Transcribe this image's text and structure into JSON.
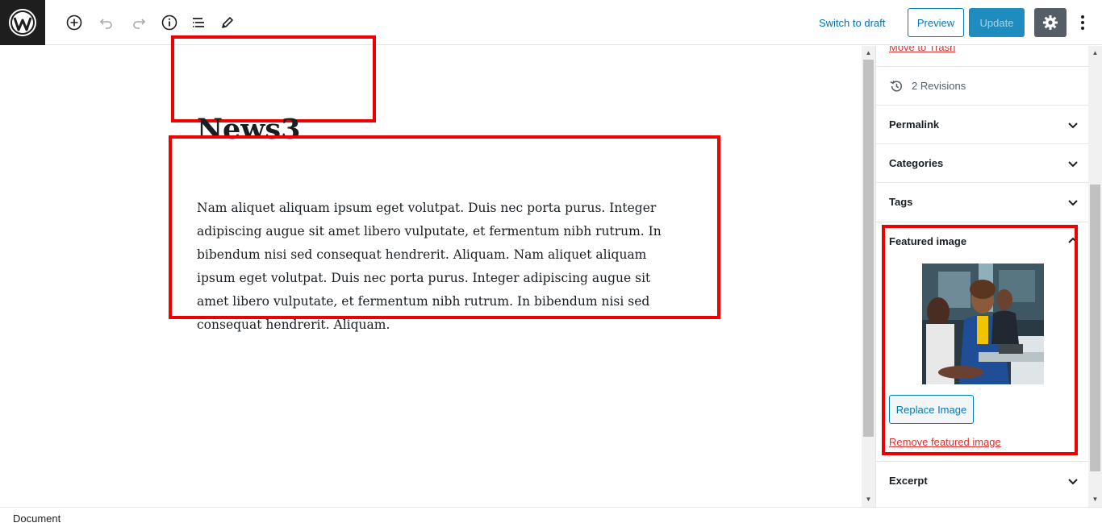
{
  "toolbar": {
    "logo_icon": "wordpress-logo-icon",
    "add_block_icon": "plus-circle-icon",
    "undo_icon": "undo-icon",
    "redo_icon": "redo-icon",
    "info_icon": "info-icon",
    "outline_icon": "list-icon",
    "tools_icon": "pencil-icon",
    "switch_to_draft": "Switch to draft",
    "preview": "Preview",
    "update": "Update",
    "settings_icon": "gear-icon",
    "more_icon": "more-vertical-icon"
  },
  "post": {
    "title": "News3",
    "paragraph": "Nam aliquet aliquam ipsum eget volutpat. Duis nec porta purus. Integer adipiscing augue sit amet libero vulputate, et fermentum nibh rutrum. In bibendum nisi sed consequat hendrerit. Aliquam. Nam aliquet aliquam ipsum eget volutpat. Duis nec porta purus. Integer adipiscing augue sit amet libero vulputate, et fermentum nibh rutrum. In bibendum nisi sed consequat hendrerit. Aliquam."
  },
  "sidebar": {
    "move_to_trash": "Move to Trash",
    "revisions": "2 Revisions",
    "panels": [
      {
        "label": "Permalink"
      },
      {
        "label": "Categories"
      },
      {
        "label": "Tags"
      }
    ],
    "featured_image": {
      "label": "Featured image",
      "replace": "Replace Image",
      "remove": "Remove featured image"
    },
    "excerpt": "Excerpt"
  },
  "footer": {
    "breadcrumb": "Document"
  },
  "colors": {
    "accent": "#007cba",
    "update_bg": "#1e8cbe",
    "danger": "#dc3232",
    "highlight": "#ee0000"
  }
}
